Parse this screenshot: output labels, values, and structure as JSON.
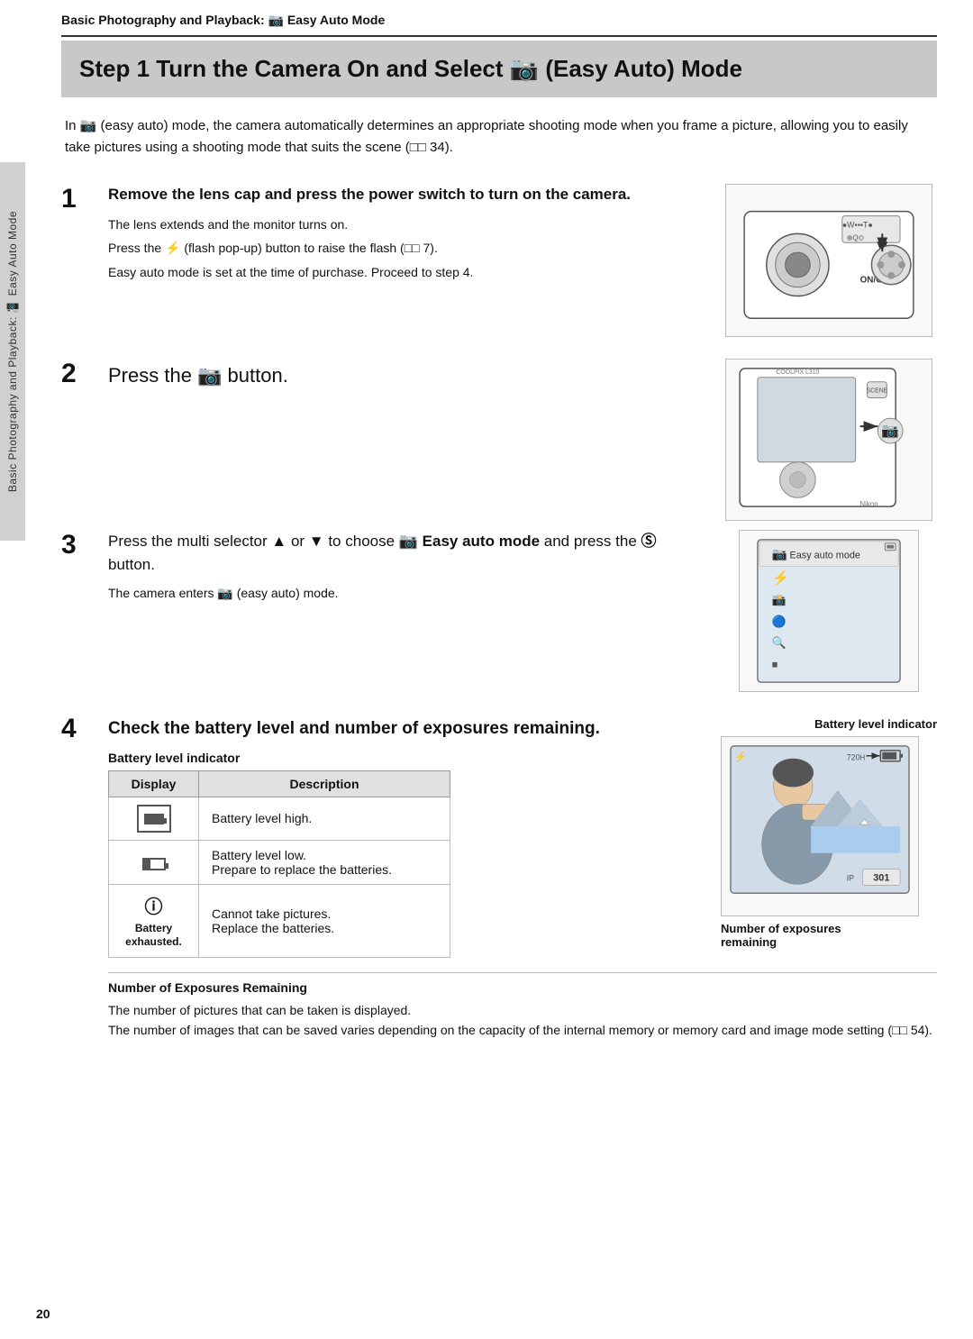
{
  "header": {
    "title": "Basic Photography and Playback: ",
    "icon": "🎥",
    "subtitle": "Easy Auto Mode"
  },
  "page_title": "Step 1 Turn the Camera On and Select  (Easy Auto) Mode",
  "intro": "In  (easy auto) mode, the camera automatically determines an appropriate shooting mode when you frame a picture, allowing you to easily take pictures using a shooting mode that suits the scene (  34).",
  "side_tab": "Basic Photography and Playback:  Easy Auto Mode",
  "steps": [
    {
      "number": "1",
      "heading": "Remove the lens cap and press the power switch to turn on the camera.",
      "lines": [
        "The lens extends and the monitor turns on.",
        "Press the  (flash pop-up) button to raise the flash (  7).",
        "Easy auto mode is set at the time of purchase. Proceed to step 4."
      ]
    },
    {
      "number": "2",
      "heading": "Press the  button."
    },
    {
      "number": "3",
      "heading": "Press the multi selector ▲ or ▼ to choose  Easy auto mode and press the  button.",
      "subline": "The camera enters  (easy auto) mode."
    },
    {
      "number": "4",
      "heading": "Check the battery level and number of exposures remaining.",
      "battery_label": "Battery level indicator",
      "table_headers": [
        "Display",
        "Description"
      ],
      "table_rows": [
        {
          "display_icon": "battery_high",
          "description": "Battery level high."
        },
        {
          "display_icon": "battery_low",
          "description": "Battery level low.\nPrepare to replace the batteries."
        },
        {
          "display_icon": "battery_exhausted",
          "display_label": "Battery\nexhausted.",
          "description": "Cannot take pictures.\nReplace the batteries."
        }
      ],
      "exposures_heading": "Number of Exposures Remaining",
      "exposures_lines": [
        "The number of pictures that can be taken is displayed.",
        "The number of images that can be saved varies depending on the capacity of the internal memory or memory card and image mode setting (  54)."
      ],
      "right_label_battery": "Battery level indicator",
      "right_label_exposures": "Number of exposures\nremaining"
    }
  ],
  "page_number": "20"
}
